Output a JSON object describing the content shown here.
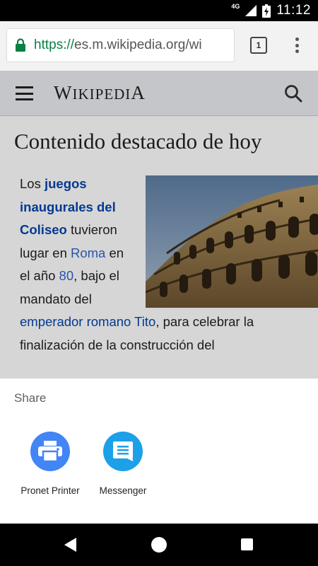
{
  "status_bar": {
    "network": "4G",
    "time": "11:12"
  },
  "browser": {
    "url_scheme": "https://",
    "url_rest": "es.m.wikipedia.org/wi",
    "tab_count": "1",
    "icons": {
      "lock": "lock-icon",
      "menu": "more-vert-icon"
    }
  },
  "wiki": {
    "logo": "Wikipedia",
    "page_title": "Contenido destacado de hoy",
    "article": {
      "t1": "Los ",
      "link1": "juegos inaugurales del Coliseo",
      "t2": " tuvieron lugar en ",
      "link2": "Roma",
      "t3": " en el año ",
      "link3": "80",
      "t4": ", bajo el mandato del ",
      "link4": "emperador romano",
      "t5": " ",
      "link5": "Tito",
      "t6": ", para celebrar la finalización de la construcción del"
    },
    "colors": {
      "link": "#3366cc",
      "link_visited": "#0645ad",
      "header_bg": "#eaecf0"
    }
  },
  "share_sheet": {
    "title": "Share",
    "apps": [
      {
        "label": "Pronet Printer",
        "icon": "printer-icon",
        "color": "#4285f4"
      },
      {
        "label": "Messenger",
        "icon": "message-icon",
        "color": "#1ca0e8"
      }
    ]
  },
  "nav_bar": {
    "icons": [
      "back-icon",
      "home-icon",
      "recents-icon"
    ]
  }
}
